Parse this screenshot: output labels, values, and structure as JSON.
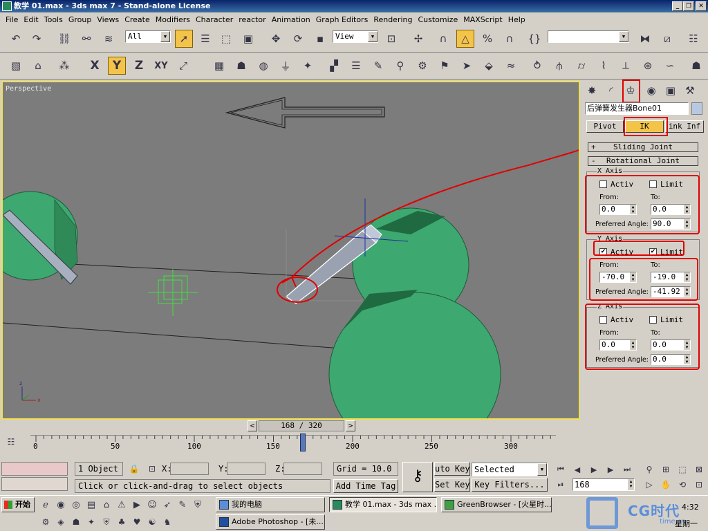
{
  "window": {
    "title": "教学 01.max - 3ds max 7 - Stand-alone License",
    "minimize": "_",
    "restore": "❐",
    "close": "✕"
  },
  "menu": [
    "File",
    "Edit",
    "Tools",
    "Group",
    "Views",
    "Create",
    "Modifiers",
    "Character",
    "reactor",
    "Animation",
    "Graph Editors",
    "Rendering",
    "Customize",
    "MAXScript",
    "Help"
  ],
  "toolbar": {
    "selection_filter": "All",
    "ref_coord": "View",
    "axis_x": "X",
    "axis_y": "Y",
    "axis_z": "Z",
    "axis_xy": "XY"
  },
  "viewport": {
    "label": "Perspective"
  },
  "command_panel": {
    "object_name": "后弹簧发生器Bone01",
    "tabs": {
      "pivot": "Pivot",
      "ik": "IK",
      "link_info": "ink Inf"
    },
    "sliding_joint": {
      "toggle": "+",
      "title": "Sliding Joint"
    },
    "rotational_joint": {
      "toggle": "-",
      "title": "Rotational Joint"
    },
    "x_axis": {
      "title": "X Axis",
      "active": "Activ",
      "limited": "Limit",
      "from_label": "From:",
      "to_label": "To:",
      "from": "0.0",
      "to": "0.0",
      "pref_label": "Preferred Angle:",
      "pref": "90.0",
      "active_checked": "",
      "limited_checked": ""
    },
    "y_axis": {
      "title": "Y Axis",
      "active": "Activ",
      "limited": "Limit",
      "from_label": "From:",
      "to_label": "To:",
      "from": "-70.0",
      "to": "-19.0",
      "pref_label": "Preferred Angle:",
      "pref": "-41.92",
      "active_checked": "✔",
      "limited_checked": "✔"
    },
    "z_axis": {
      "title": "Z Axis",
      "active": "Activ",
      "limited": "Limit",
      "from_label": "From:",
      "to_label": "To:",
      "from": "0.0",
      "to": "0.0",
      "pref_label": "Preferred Angle:",
      "pref": "0.0",
      "active_checked": "",
      "limited_checked": ""
    }
  },
  "timeline": {
    "frame": "168 / 320",
    "ticks": [
      "0",
      "50",
      "100",
      "150",
      "200",
      "250",
      "300"
    ],
    "prev": "<",
    "next": ">"
  },
  "status": {
    "selection": "1 Object",
    "x_label": "X:",
    "y_label": "Y:",
    "z_label": "Z:",
    "grid": "Grid = 10.0",
    "auto_key": "uto Key",
    "selected": "Selected",
    "set_key": "Set Key",
    "key_filters": "Key Filters...",
    "prompt": "Click or click-and-drag to select objects",
    "add_time_tag": "Add Time Tag",
    "current_frame": "168"
  },
  "taskbar": {
    "start": "开始",
    "tasks": [
      "我的电脑",
      "教学 01.max - 3ds max ...",
      "GreenBrowser - [火星时...",
      "Adobe Photoshop - [未..."
    ],
    "clock": "4:32",
    "day": "星期一",
    "watermark_domain": "time.cn"
  },
  "colors": {
    "accent": "#f4c44a",
    "annotation": "#e00000",
    "sphere": "#3da870",
    "title_bg": "#0a246a"
  }
}
